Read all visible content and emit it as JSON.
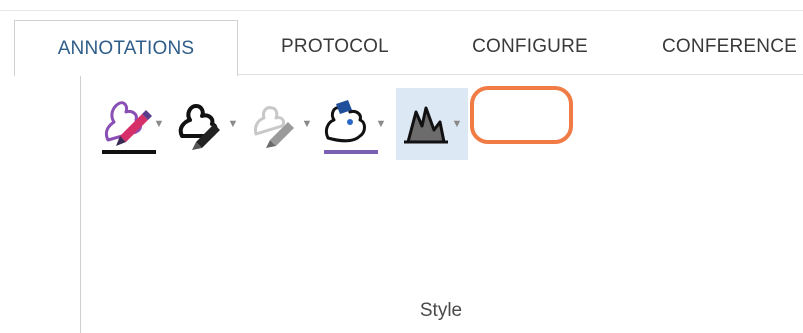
{
  "tabs": [
    {
      "id": "annotations",
      "label": "ANNOTATIONS",
      "active": true
    },
    {
      "id": "protocol",
      "label": "PROTOCOL",
      "active": false
    },
    {
      "id": "configure",
      "label": "CONFIGURE",
      "active": false
    },
    {
      "id": "conference",
      "label": "CONFERENCE",
      "active": false
    }
  ],
  "style_group": {
    "label": "Style",
    "tools": [
      {
        "icon": "pen-color-icon",
        "underline_color": "#111111"
      },
      {
        "icon": "freeform-shape-icon"
      },
      {
        "icon": "pen-fade-icon"
      },
      {
        "icon": "fill-color-icon",
        "underline_color": "#7b5fb0"
      },
      {
        "icon": "area-style-icon",
        "selected": true
      }
    ]
  },
  "colors": {
    "active_tab_text": "#2f5d8a",
    "highlight_ring": "#f07b45",
    "selected_tool_bg": "#dde8f5"
  }
}
